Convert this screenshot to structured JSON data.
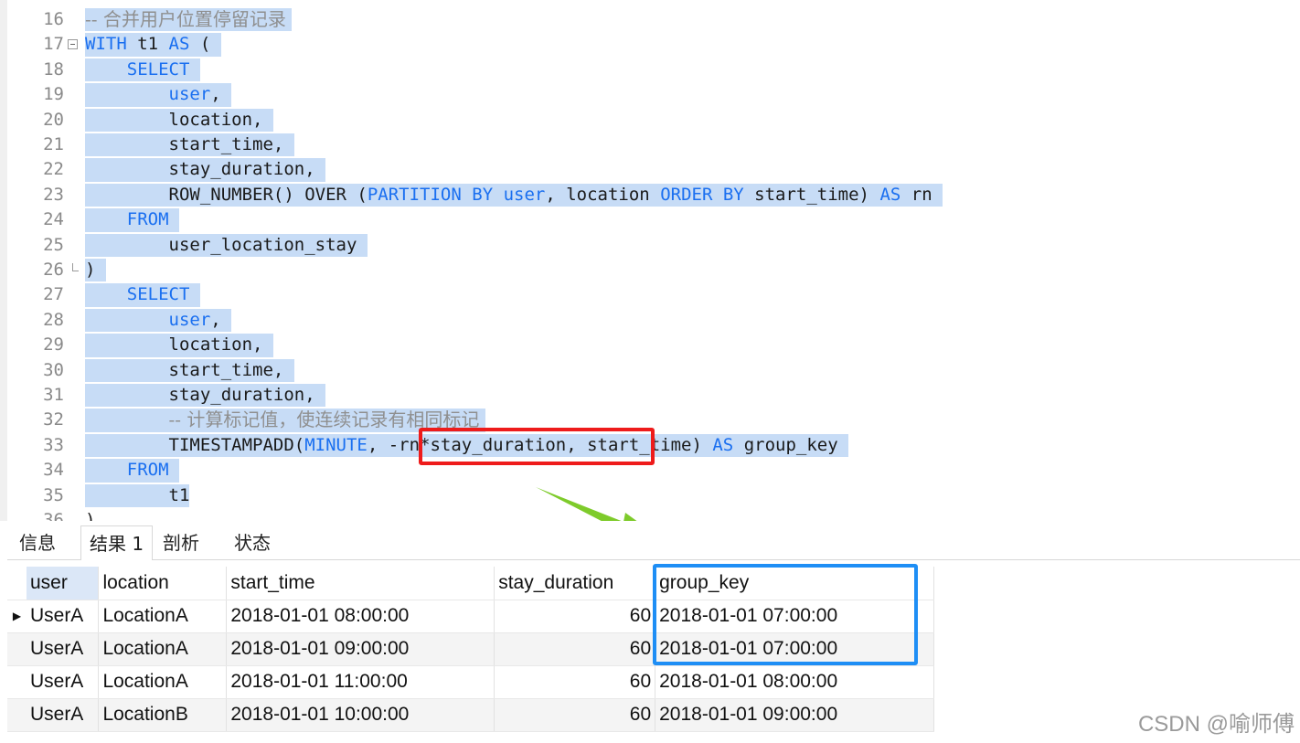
{
  "editor": {
    "lines": [
      {
        "n": "16",
        "fold": "",
        "segs": [
          {
            "t": "-- 合并用户位置停留记录 ",
            "c": "cm"
          }
        ]
      },
      {
        "n": "17",
        "fold": "open",
        "segs": [
          {
            "t": "WITH",
            "c": "kw"
          },
          {
            "t": " t1 ",
            "c": ""
          },
          {
            "t": "AS",
            "c": "kw"
          },
          {
            "t": " ( ",
            "c": ""
          }
        ]
      },
      {
        "n": "18",
        "fold": "",
        "segs": [
          {
            "t": "    ",
            "c": ""
          },
          {
            "t": "SELECT",
            "c": "kw"
          },
          {
            "t": " ",
            "c": ""
          }
        ]
      },
      {
        "n": "19",
        "fold": "",
        "segs": [
          {
            "t": "        ",
            "c": ""
          },
          {
            "t": "user",
            "c": "kw"
          },
          {
            "t": ", ",
            "c": ""
          }
        ]
      },
      {
        "n": "20",
        "fold": "",
        "segs": [
          {
            "t": "        location, ",
            "c": ""
          }
        ]
      },
      {
        "n": "21",
        "fold": "",
        "segs": [
          {
            "t": "        start_time, ",
            "c": ""
          }
        ]
      },
      {
        "n": "22",
        "fold": "",
        "segs": [
          {
            "t": "        stay_duration, ",
            "c": ""
          }
        ]
      },
      {
        "n": "23",
        "fold": "",
        "segs": [
          {
            "t": "        ROW_NUMBER() OVER (",
            "c": ""
          },
          {
            "t": "PARTITION BY",
            "c": "kw"
          },
          {
            "t": " ",
            "c": ""
          },
          {
            "t": "user",
            "c": "kw"
          },
          {
            "t": ", location ",
            "c": ""
          },
          {
            "t": "ORDER BY",
            "c": "kw"
          },
          {
            "t": " start_time) ",
            "c": ""
          },
          {
            "t": "AS",
            "c": "kw"
          },
          {
            "t": " rn ",
            "c": ""
          }
        ]
      },
      {
        "n": "24",
        "fold": "",
        "segs": [
          {
            "t": "    ",
            "c": ""
          },
          {
            "t": "FROM",
            "c": "kw"
          },
          {
            "t": " ",
            "c": ""
          }
        ]
      },
      {
        "n": "25",
        "fold": "",
        "segs": [
          {
            "t": "        user_location_stay ",
            "c": ""
          }
        ]
      },
      {
        "n": "26",
        "fold": "end",
        "segs": [
          {
            "t": ") ",
            "c": ""
          }
        ]
      },
      {
        "n": "27",
        "fold": "",
        "segs": [
          {
            "t": "    ",
            "c": ""
          },
          {
            "t": "SELECT",
            "c": "kw"
          },
          {
            "t": " ",
            "c": ""
          }
        ]
      },
      {
        "n": "28",
        "fold": "",
        "segs": [
          {
            "t": "        ",
            "c": ""
          },
          {
            "t": "user",
            "c": "kw"
          },
          {
            "t": ", ",
            "c": ""
          }
        ]
      },
      {
        "n": "29",
        "fold": "",
        "segs": [
          {
            "t": "        location, ",
            "c": ""
          }
        ]
      },
      {
        "n": "30",
        "fold": "",
        "segs": [
          {
            "t": "        start_time, ",
            "c": ""
          }
        ]
      },
      {
        "n": "31",
        "fold": "",
        "segs": [
          {
            "t": "        stay_duration, ",
            "c": ""
          }
        ]
      },
      {
        "n": "32",
        "fold": "",
        "segs": [
          {
            "t": "        ",
            "c": ""
          },
          {
            "t": "-- 计算标记值，使连续记录有相同标记 ",
            "c": "cm"
          }
        ]
      },
      {
        "n": "33",
        "fold": "",
        "segs": [
          {
            "t": "        TIMESTAMPADD(",
            "c": ""
          },
          {
            "t": "MINUTE",
            "c": "kw"
          },
          {
            "t": ", -rn*stay_duration, start_time) ",
            "c": ""
          },
          {
            "t": "AS",
            "c": "kw"
          },
          {
            "t": " group_key ",
            "c": ""
          }
        ]
      },
      {
        "n": "34",
        "fold": "",
        "segs": [
          {
            "t": "    ",
            "c": ""
          },
          {
            "t": "FROM",
            "c": "kw"
          },
          {
            "t": " ",
            "c": ""
          }
        ]
      },
      {
        "n": "35",
        "fold": "",
        "segs": [
          {
            "t": "        t1",
            "c": ""
          }
        ]
      },
      {
        "n": "36",
        "fold": "",
        "segs": [
          {
            "t": ")",
            "c": ""
          }
        ]
      }
    ]
  },
  "tabs": [
    {
      "label": "信息",
      "active": false
    },
    {
      "label": "结果 1",
      "active": true
    },
    {
      "label": "剖析",
      "active": false
    },
    {
      "label": "状态",
      "active": false
    }
  ],
  "grid": {
    "columns": [
      "user",
      "location",
      "start_time",
      "stay_duration",
      "group_key"
    ],
    "rows": [
      [
        "UserA",
        "LocationA",
        "2018-01-01 08:00:00",
        "60",
        "2018-01-01 07:00:00"
      ],
      [
        "UserA",
        "LocationA",
        "2018-01-01 09:00:00",
        "60",
        "2018-01-01 07:00:00"
      ],
      [
        "UserA",
        "LocationA",
        "2018-01-01 11:00:00",
        "60",
        "2018-01-01 08:00:00"
      ],
      [
        "UserA",
        "LocationB",
        "2018-01-01 10:00:00",
        "60",
        "2018-01-01 09:00:00"
      ]
    ]
  },
  "watermark": "CSDN @喻师傅",
  "colors": {
    "keyword": "#1a6ff0",
    "selection": "#c7dcf6",
    "red_box": "#ee1b1b",
    "blue_box": "#1e8ef5",
    "arrow": "#7ecb2b"
  }
}
